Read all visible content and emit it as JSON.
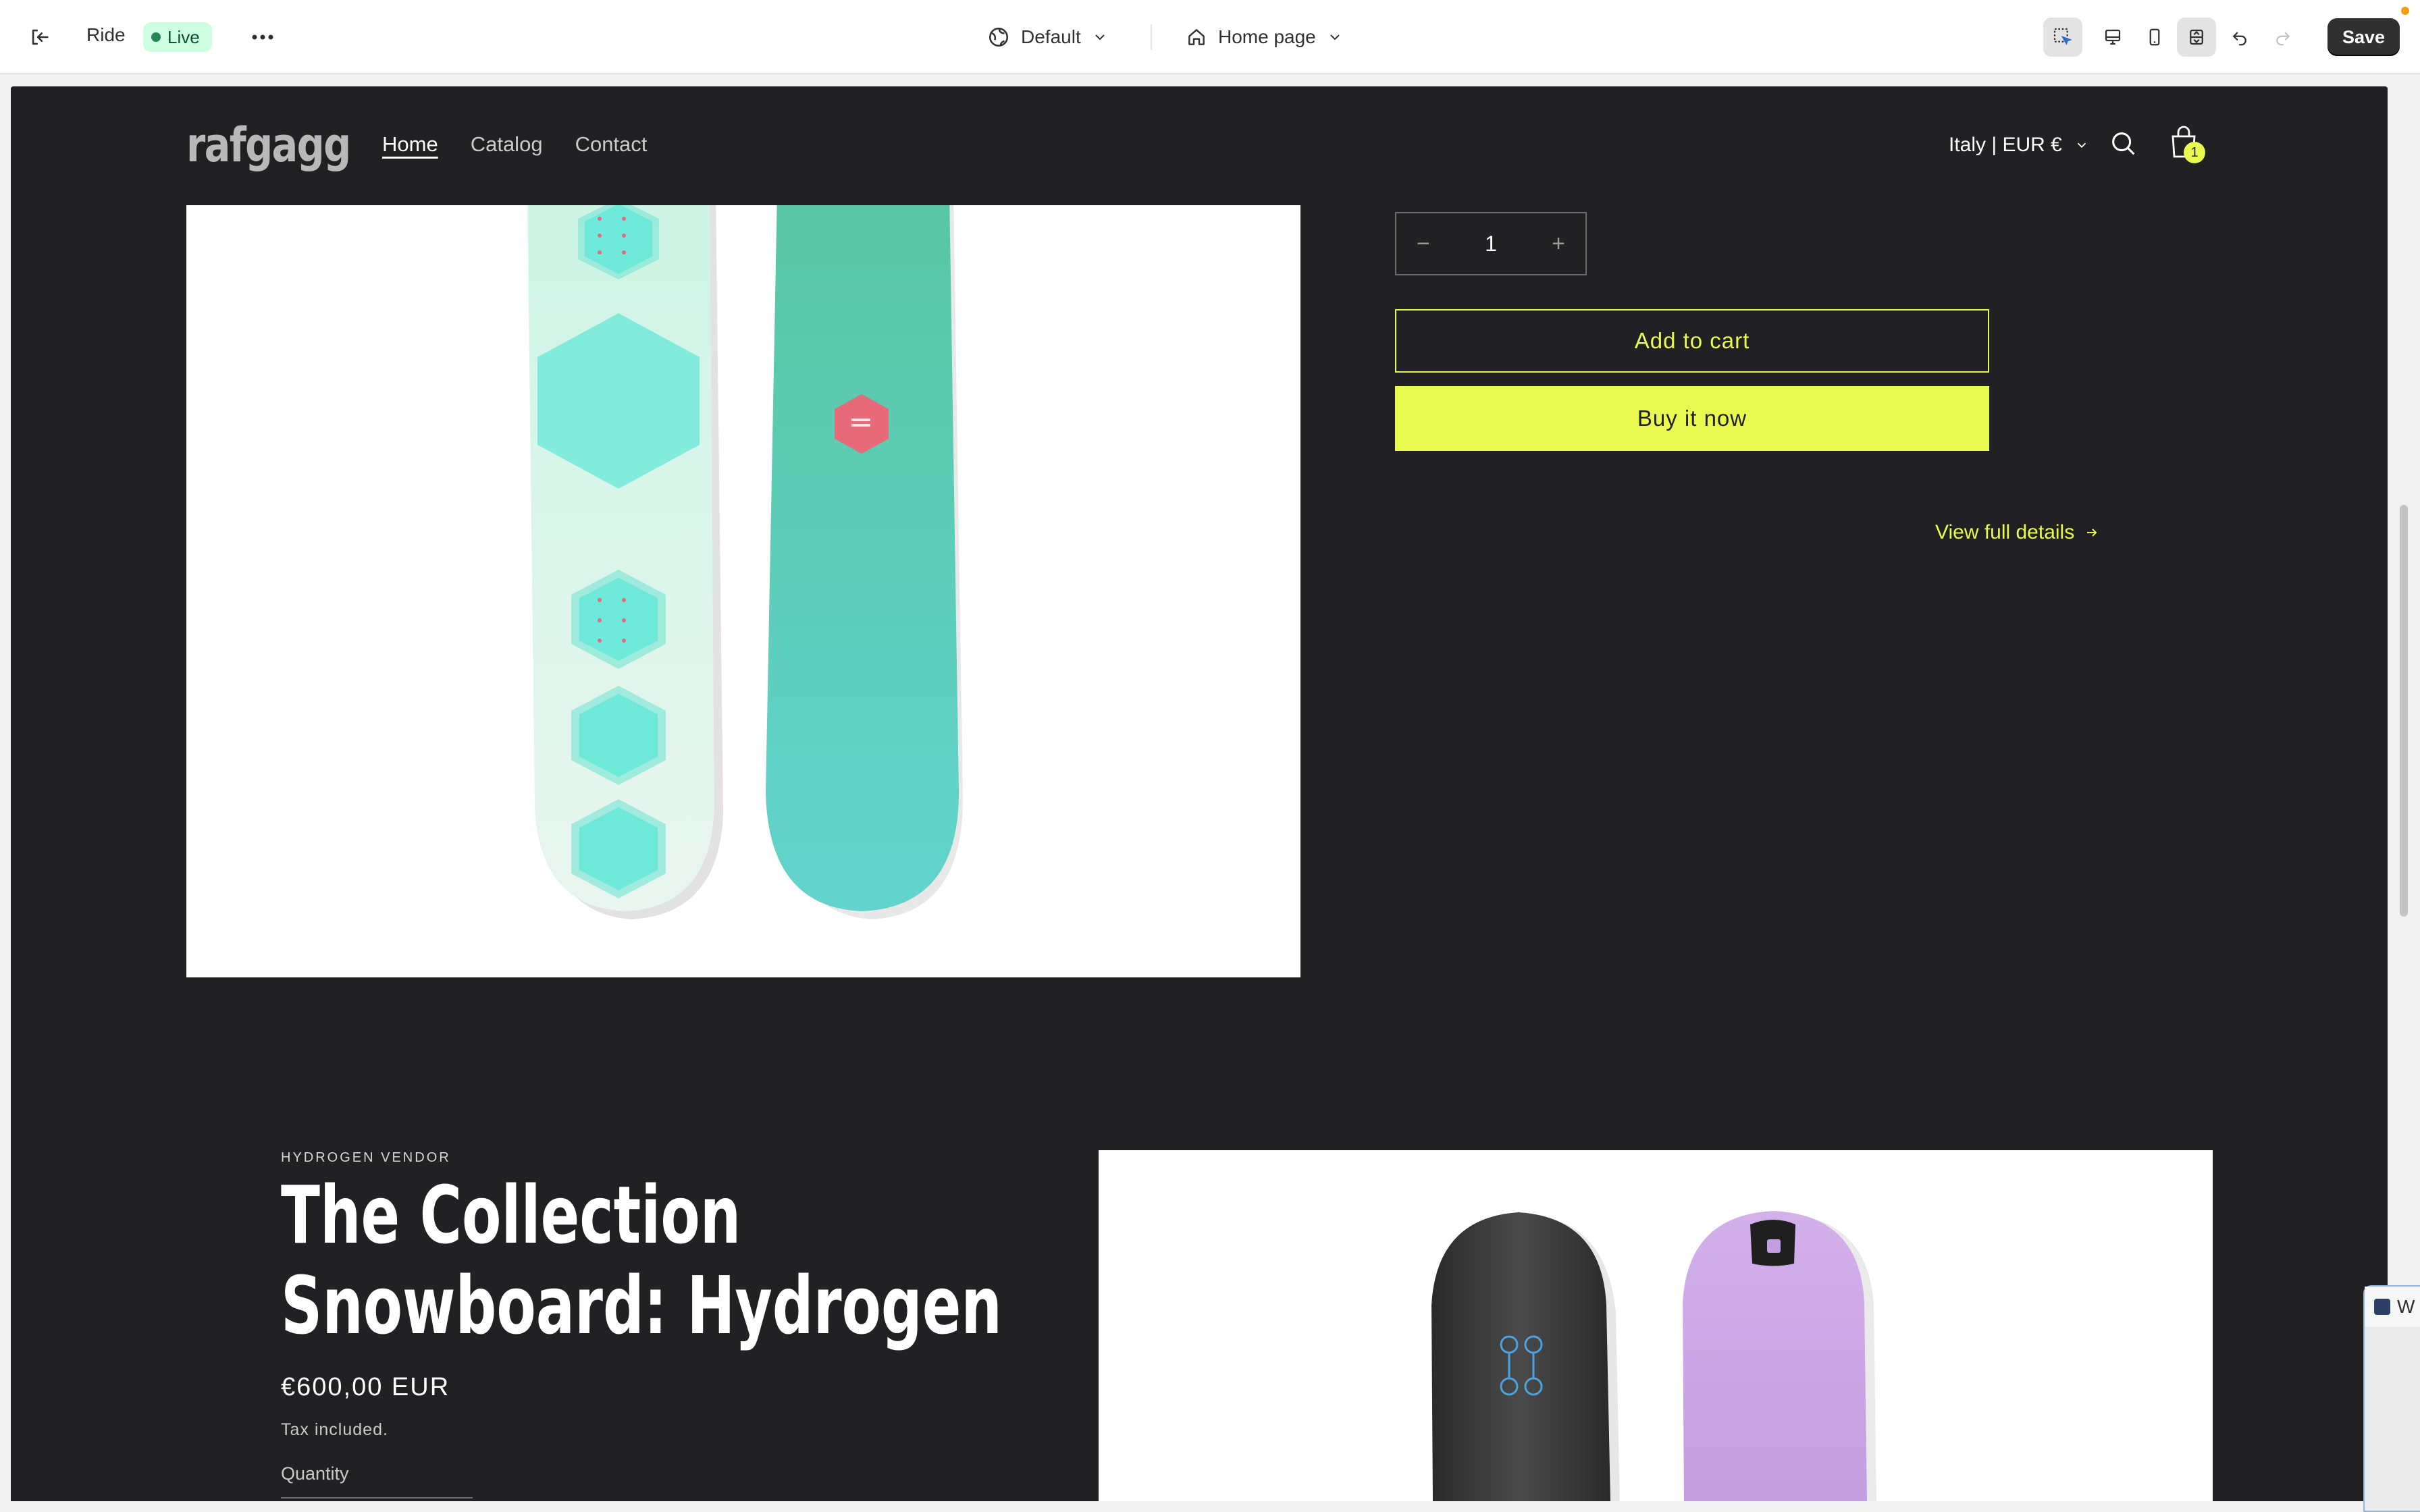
{
  "topbar": {
    "store_name": "Ride",
    "live_label": "Live",
    "more_label": "•••",
    "theme_label": "Default",
    "page_label": "Home page",
    "save_label": "Save"
  },
  "store": {
    "logo": "rafgagg",
    "nav": [
      {
        "label": "Home",
        "active": true
      },
      {
        "label": "Catalog",
        "active": false
      },
      {
        "label": "Contact",
        "active": false
      }
    ],
    "country": "Italy | EUR €",
    "cart_count": "1"
  },
  "product1": {
    "quantity": "1",
    "add_to_cart": "Add to cart",
    "buy_now": "Buy it now",
    "view_details": "View full details",
    "board_colors": {
      "left_board": "#dff6ec",
      "right_board": "#5fd0c0",
      "hex_accent": "#6ee8d8",
      "logo_accent": "#e66a7a"
    }
  },
  "product2": {
    "vendor": "HYDROGEN VENDOR",
    "title_line1": "The Collection",
    "title_line2": "Snowboard: Hydrogen",
    "price": "€600,00 EUR",
    "tax": "Tax included.",
    "quantity_label": "Quantity",
    "board_colors": {
      "left_board": "#3a3a3a",
      "right_board": "#c39ee0",
      "binding_accent": "#4aa3e0"
    }
  },
  "floating_window": {
    "title_initial": "W"
  },
  "colors": {
    "accent": "#e8f94f",
    "canvas": "#212123",
    "live_badge_bg": "#cdfee1"
  }
}
